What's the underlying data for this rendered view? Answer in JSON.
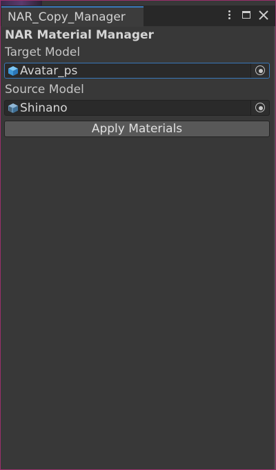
{
  "window": {
    "tab_title": "NAR_Copy_Manager",
    "menu_icon": "kebab-menu-icon",
    "maximize_icon": "maximize-icon",
    "close_icon": "close-icon"
  },
  "panel": {
    "header": "NAR Material Manager",
    "target": {
      "label": "Target Model",
      "value": "Avatar_ps",
      "icon": "prefab-cube-icon",
      "picker_icon": "object-picker-icon"
    },
    "source": {
      "label": "Source Model",
      "value": "Shinano",
      "icon": "prefab-cube-icon",
      "picker_icon": "object-picker-icon"
    },
    "apply_button": "Apply Materials"
  },
  "colors": {
    "window_border": "#9b2f6c",
    "panel_bg": "#383838",
    "field_bg": "#2a2a2a",
    "focus_accent": "#3a79bb",
    "button_bg": "#585858",
    "cube_icon": "#4aa8e8"
  }
}
